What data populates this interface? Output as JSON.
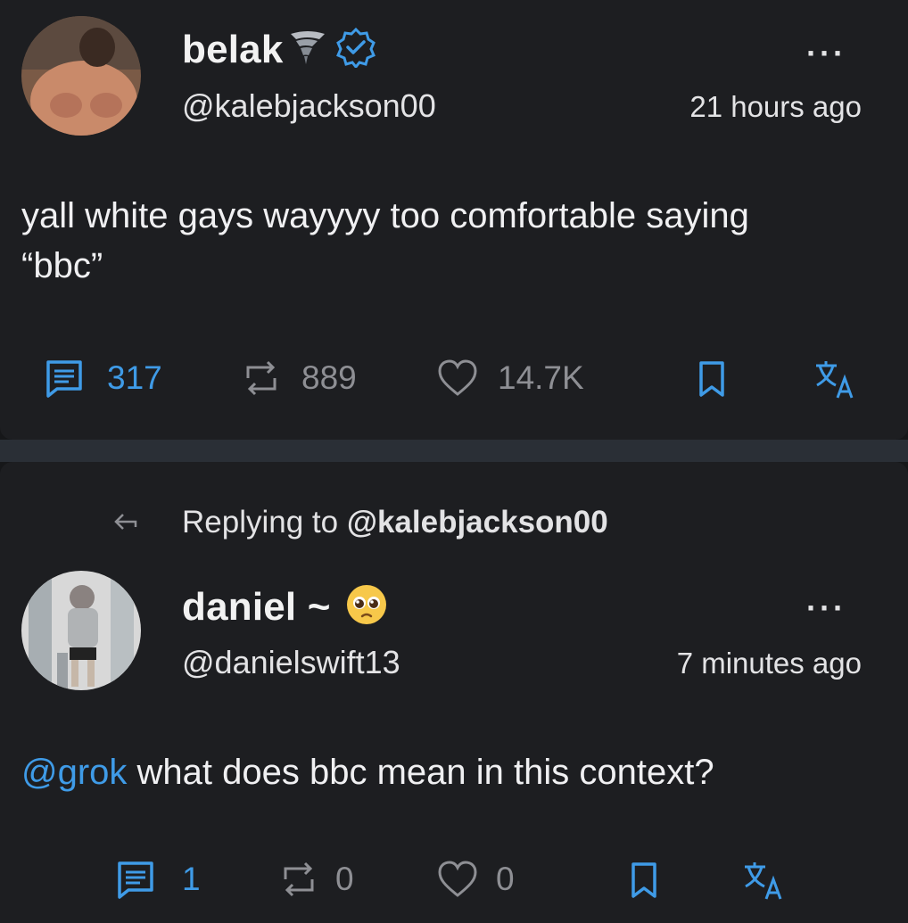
{
  "post": {
    "display_name": "belak",
    "name_emoji": "tornado-emoji",
    "verified": true,
    "handle": "@kalebjackson00",
    "time": "21 hours ago",
    "more": "···",
    "text_line1": "yall white gays wayyyy too comfortable saying",
    "text_line2": "“bbc”",
    "replies": "317",
    "reposts": "889",
    "likes": "14.7K"
  },
  "reply": {
    "replying_prefix": "Replying to ",
    "replying_to": "@kalebjackson00",
    "display_name": "daniel ~",
    "name_emoji": "pleading-face-emoji",
    "handle": "@danielswift13",
    "time": "7 minutes ago",
    "more": "···",
    "mention": "@grok",
    "text": " what does bbc mean in this context?",
    "replies": "1",
    "reposts": "0",
    "likes": "0"
  },
  "colors": {
    "accent": "#3f9be7",
    "muted": "#8e8f94",
    "background": "#1d1e21"
  }
}
